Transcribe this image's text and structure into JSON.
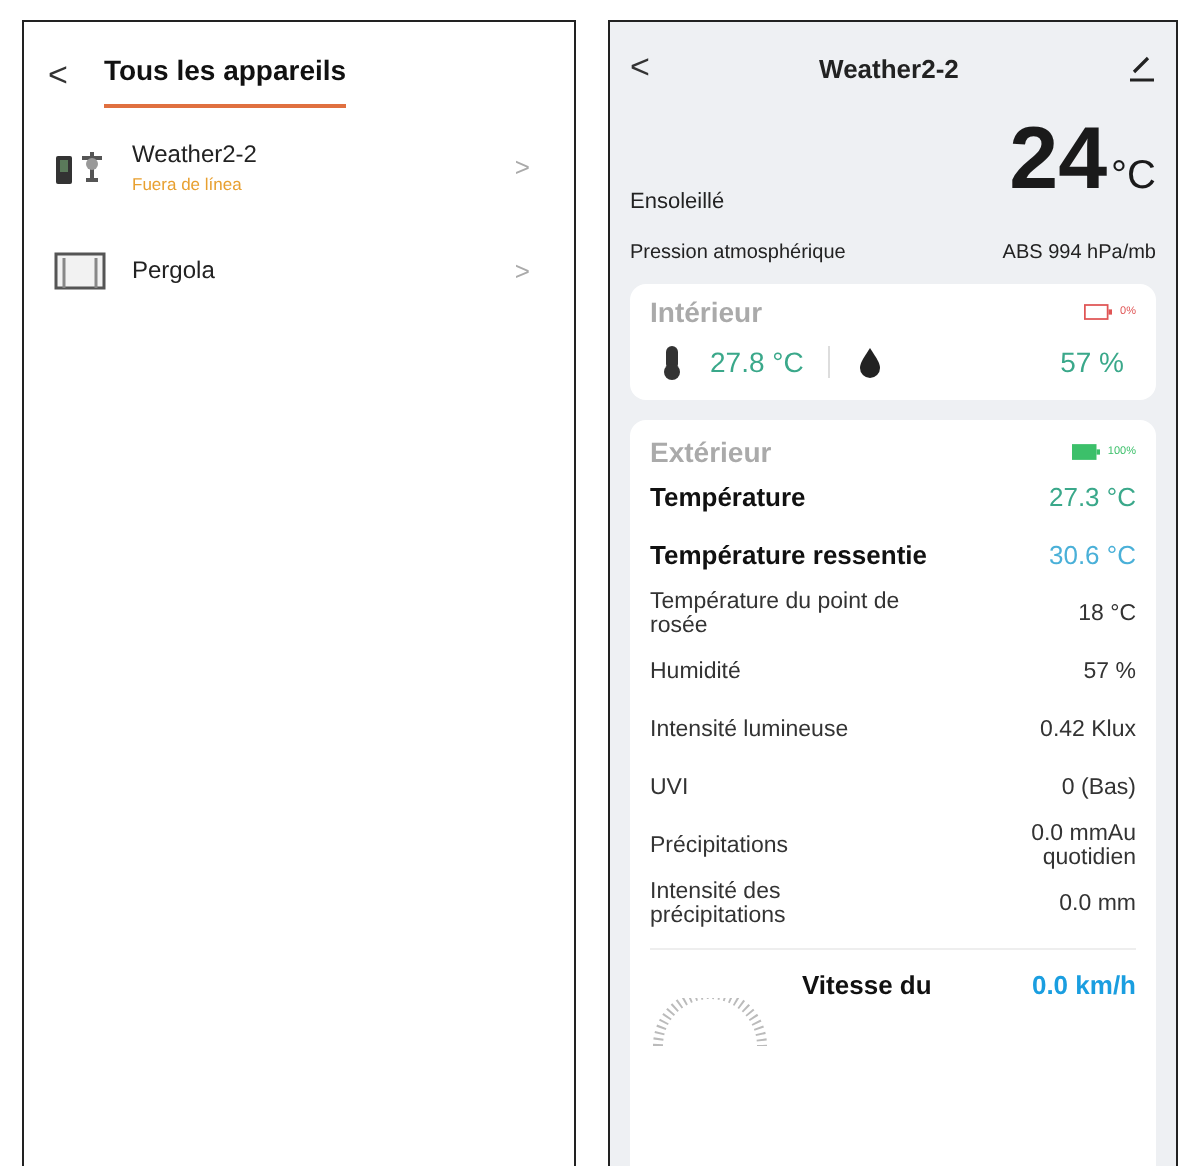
{
  "devices_screen": {
    "back": "<",
    "title": "Tous les appareils",
    "devices": [
      {
        "kind": "station",
        "name": "Weather2-2",
        "status": "Fuera de línea",
        "chevron": ">"
      },
      {
        "kind": "pergola",
        "name": "Pergola",
        "chevron": ">"
      }
    ]
  },
  "weather_screen": {
    "back": "<",
    "title": "Weather2-2",
    "temperature": "24",
    "unit": "°C",
    "condition": "Ensoleillé",
    "pressure_label": "Pression atmosphérique",
    "pressure_value": "ABS 994 hPa/mb",
    "indoor": {
      "title": "Intérieur",
      "battery": {
        "label": "0%",
        "color": "#e05555"
      },
      "temperature": "27.8 °C",
      "humidity": "57 %"
    },
    "outdoor": {
      "title": "Extérieur",
      "battery": {
        "label": "100%",
        "color": "#3cc06a"
      },
      "rows": [
        {
          "kind": "main",
          "label": "Température",
          "value": "27.3 °C",
          "color": "#3aa88a"
        },
        {
          "kind": "main",
          "label": "Température ressentie",
          "value": "30.6 °C",
          "color": "#4ab0d8"
        },
        {
          "kind": "plain",
          "label": "Température du point de rosée",
          "value": "18 °C",
          "color": "#333333"
        },
        {
          "kind": "plain",
          "label": "Humidité",
          "value": "57 %",
          "color": "#333333"
        },
        {
          "kind": "plain",
          "label": "Intensité lumineuse",
          "value": "0.42 Klux",
          "color": "#333333"
        },
        {
          "kind": "plain",
          "label": "UVI",
          "value": "0 (Bas)",
          "color": "#333333"
        },
        {
          "kind": "plain",
          "label": "Précipitations",
          "value": "0.0 mmAu quotidien",
          "color": "#333333"
        },
        {
          "kind": "plain",
          "label": "Intensité des précipitations",
          "value": "0.0 mm",
          "color": "#333333"
        }
      ],
      "wind": {
        "label": "Vitesse du",
        "value": "0.0 km/h"
      }
    }
  }
}
